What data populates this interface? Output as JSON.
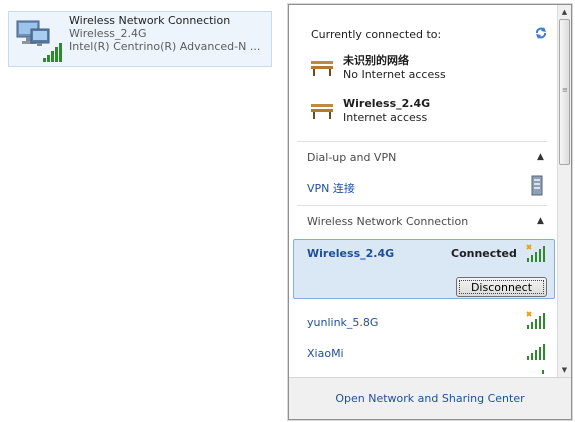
{
  "tile": {
    "name": "Wireless Network Connection",
    "ssid": "Wireless_2.4G",
    "adapter": "Intel(R) Centrino(R) Advanced-N ..."
  },
  "panel": {
    "connected_header": "Currently connected to:",
    "connections": [
      {
        "name": "未识别的网络",
        "status": "No Internet access"
      },
      {
        "name": "Wireless_2.4G",
        "status": "Internet access"
      }
    ],
    "dialup_header": "Dial-up and VPN",
    "vpn_item": "VPN 连接",
    "wireless_header": "Wireless Network Connection",
    "selected_network": {
      "name": "Wireless_2.4G",
      "status": "Connected",
      "button": "Disconnect"
    },
    "networks": [
      {
        "name": "yunlink_5.8G"
      },
      {
        "name": "XiaoMi"
      }
    ],
    "footer_link": "Open Network and Sharing Center"
  }
}
